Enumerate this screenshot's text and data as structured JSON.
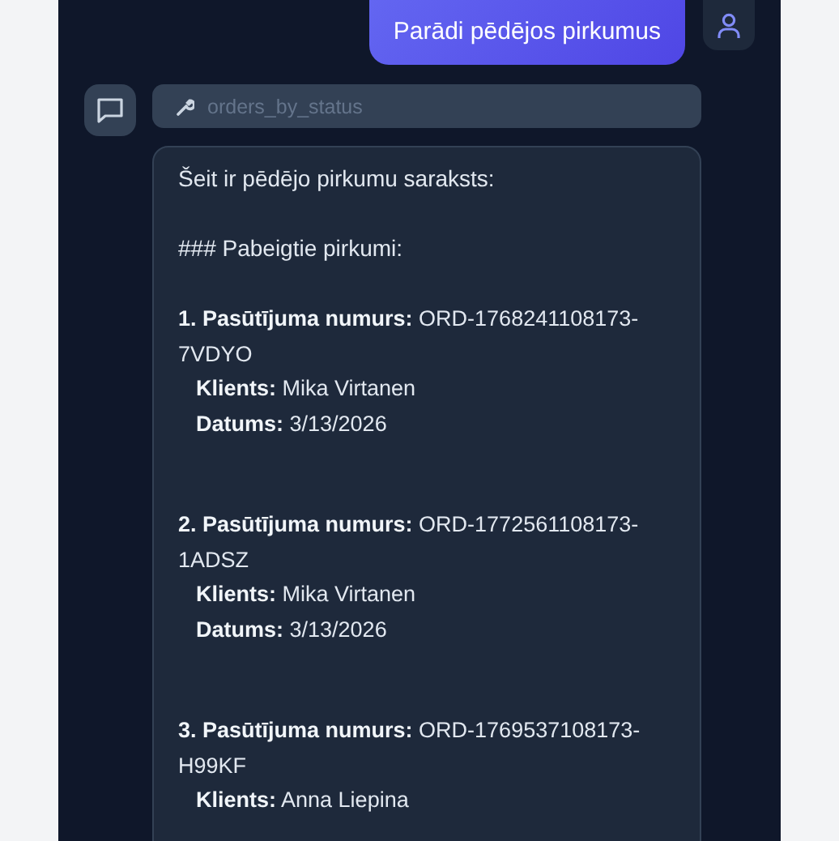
{
  "user_message": {
    "text": "Parādi pēdējos pirkumus"
  },
  "tool_call": {
    "name": "orders_by_status"
  },
  "assistant_message": {
    "intro": "Šeit ir pēdējo pirkumu saraksts:",
    "heading": "### Pabeigtie pirkumi:",
    "orders": [
      {
        "title": "**1. Pasūtījuma numurs:** ORD-1768241108173-7VDYO",
        "details": [
          "**Klients:** Mika Virtanen",
          "**Datums:** 3/13/2026"
        ]
      },
      {
        "title": "**2. Pasūtījuma numurs:** ORD-1772561108173-1ADSZ",
        "details": [
          "**Klients:** Mika Virtanen",
          "**Datums:** 3/13/2026"
        ]
      },
      {
        "title": "**3. Pasūtījuma numurs:** ORD-1769537108173-H99KF",
        "details": [
          "**Klients:** Anna Liepina"
        ]
      }
    ]
  }
}
